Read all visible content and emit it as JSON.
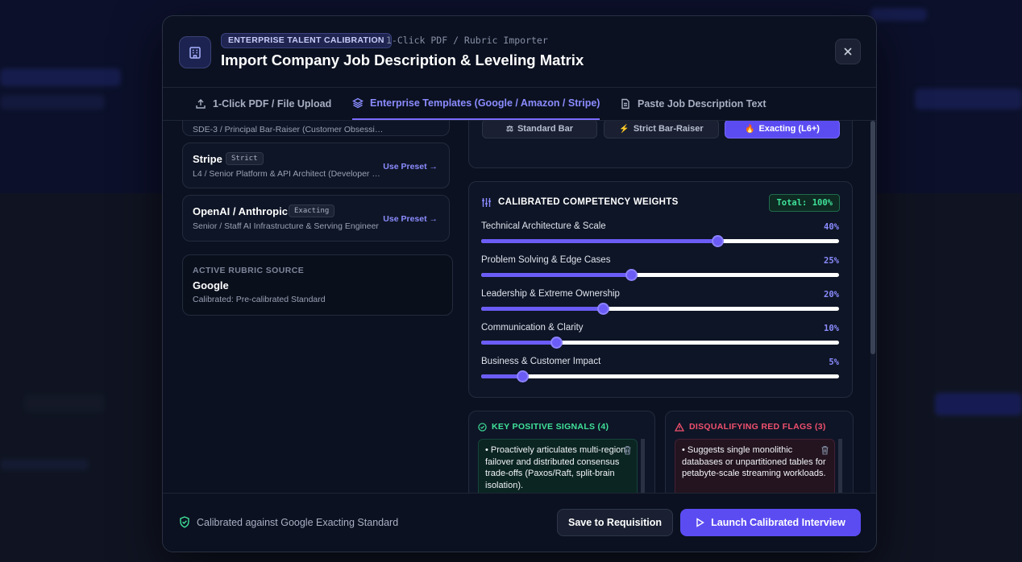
{
  "header": {
    "badge": "ENTERPRISE TALENT CALIBRATION",
    "subtitle": "1-Click PDF / Rubric Importer",
    "title": "Import Company Job Description & Leveling Matrix"
  },
  "tabs": [
    {
      "label": "1-Click PDF / File Upload",
      "icon": "upload-icon",
      "active": false
    },
    {
      "label": "Enterprise Templates (Google / Amazon / Stripe)",
      "icon": "layers-icon",
      "active": true
    },
    {
      "label": "Paste Job Description Text",
      "icon": "document-icon",
      "active": false
    }
  ],
  "presets": {
    "partial_desc": "SDE-3 / Principal Bar-Raiser (Customer Obsessio...",
    "items": [
      {
        "name": "Stripe",
        "tag": "Strict",
        "desc": "L4 / Senior Platform & API Architect (Developer Ex...",
        "link": "Use Preset →"
      },
      {
        "name": "OpenAI / Anthropic",
        "tag": "Exacting",
        "desc": "Senior / Staff AI Infrastructure & Serving Engineer",
        "link": "Use Preset →"
      }
    ]
  },
  "active_source": {
    "label": "ACTIVE RUBRIC SOURCE",
    "name": "Google",
    "calibration": "Calibrated: Pre-calibrated Standard"
  },
  "levels": [
    {
      "label": "Standard Bar",
      "icon": "scale-emoji",
      "glyph": "⚖",
      "active": false
    },
    {
      "label": "Strict Bar-Raiser",
      "icon": "lightning-icon",
      "glyph": "⚡",
      "active": false
    },
    {
      "label": "Exacting (L6+)",
      "icon": "fire-emoji",
      "glyph": "🔥",
      "active": true
    }
  ],
  "weights": {
    "title": "CALIBRATED COMPETENCY WEIGHTS",
    "total": "Total: 100%",
    "items": [
      {
        "label": "Technical Architecture & Scale",
        "value": "40%",
        "level": 0.66
      },
      {
        "label": "Problem Solving & Edge Cases",
        "value": "25%",
        "level": 0.42
      },
      {
        "label": "Leadership & Extreme Ownership",
        "value": "20%",
        "level": 0.34
      },
      {
        "label": "Communication & Clarity",
        "value": "10%",
        "level": 0.21
      },
      {
        "label": "Business & Customer Impact",
        "value": "5%",
        "level": 0.115
      }
    ]
  },
  "signals": {
    "positive_title": "KEY POSITIVE SIGNALS (4)",
    "positive_first": "• Proactively articulates multi-region failover and distributed consensus trade-offs (Paxos/Raft, split-brain isolation).",
    "negative_title": "DISQUALIFYING RED FLAGS (3)",
    "negative_first": "• Suggests single monolithic databases or unpartitioned tables for petabyte-scale streaming workloads."
  },
  "footer": {
    "note": "Calibrated against Google Exacting Standard",
    "save_label": "Save to Requisition",
    "launch_label": "Launch Calibrated Interview"
  },
  "colors": {
    "accent": "#5b4cf2",
    "positive": "#3fe39a",
    "negative": "#f0506e"
  }
}
